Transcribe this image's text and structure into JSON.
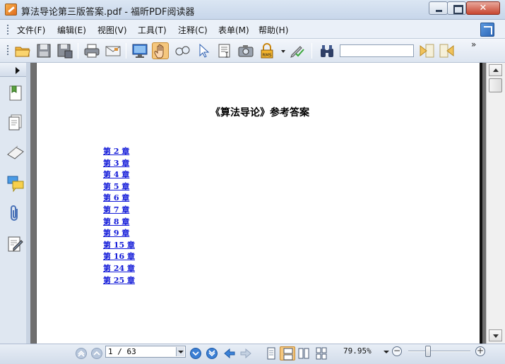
{
  "window": {
    "title": "算法导论第三版答案.pdf - 福昕PDF阅读器",
    "close_glyph": "✕"
  },
  "menu": [
    {
      "label": "文件(F)"
    },
    {
      "label": "编辑(E)"
    },
    {
      "label": "视图(V)"
    },
    {
      "label": "工具(T)"
    },
    {
      "label": "注释(C)"
    },
    {
      "label": "表单(M)"
    },
    {
      "label": "帮助(H)"
    }
  ],
  "toolbar": {
    "search_value": "",
    "more_glyph": "»",
    "active_tool": "hand-tool",
    "rms_label": "RMS"
  },
  "document": {
    "title": "《算法导论》参考答案",
    "chapters": [
      "第 2 章",
      "第 3 章",
      "第 4 章",
      "第 5 章",
      "第 6 章",
      "第 7 章",
      "第 8 章",
      "第 9 章",
      "第 15 章",
      "第 16 章",
      "第 24 章",
      "第 25 章"
    ]
  },
  "status": {
    "page_display": "1 / 63",
    "zoom": "79.95%",
    "zoom_out_glyph": "−",
    "zoom_in_glyph": "+",
    "zoom_slider_level": 0.32
  },
  "colors": {
    "link": "#1018d8",
    "active_tool_bg": "#f5c77e"
  }
}
